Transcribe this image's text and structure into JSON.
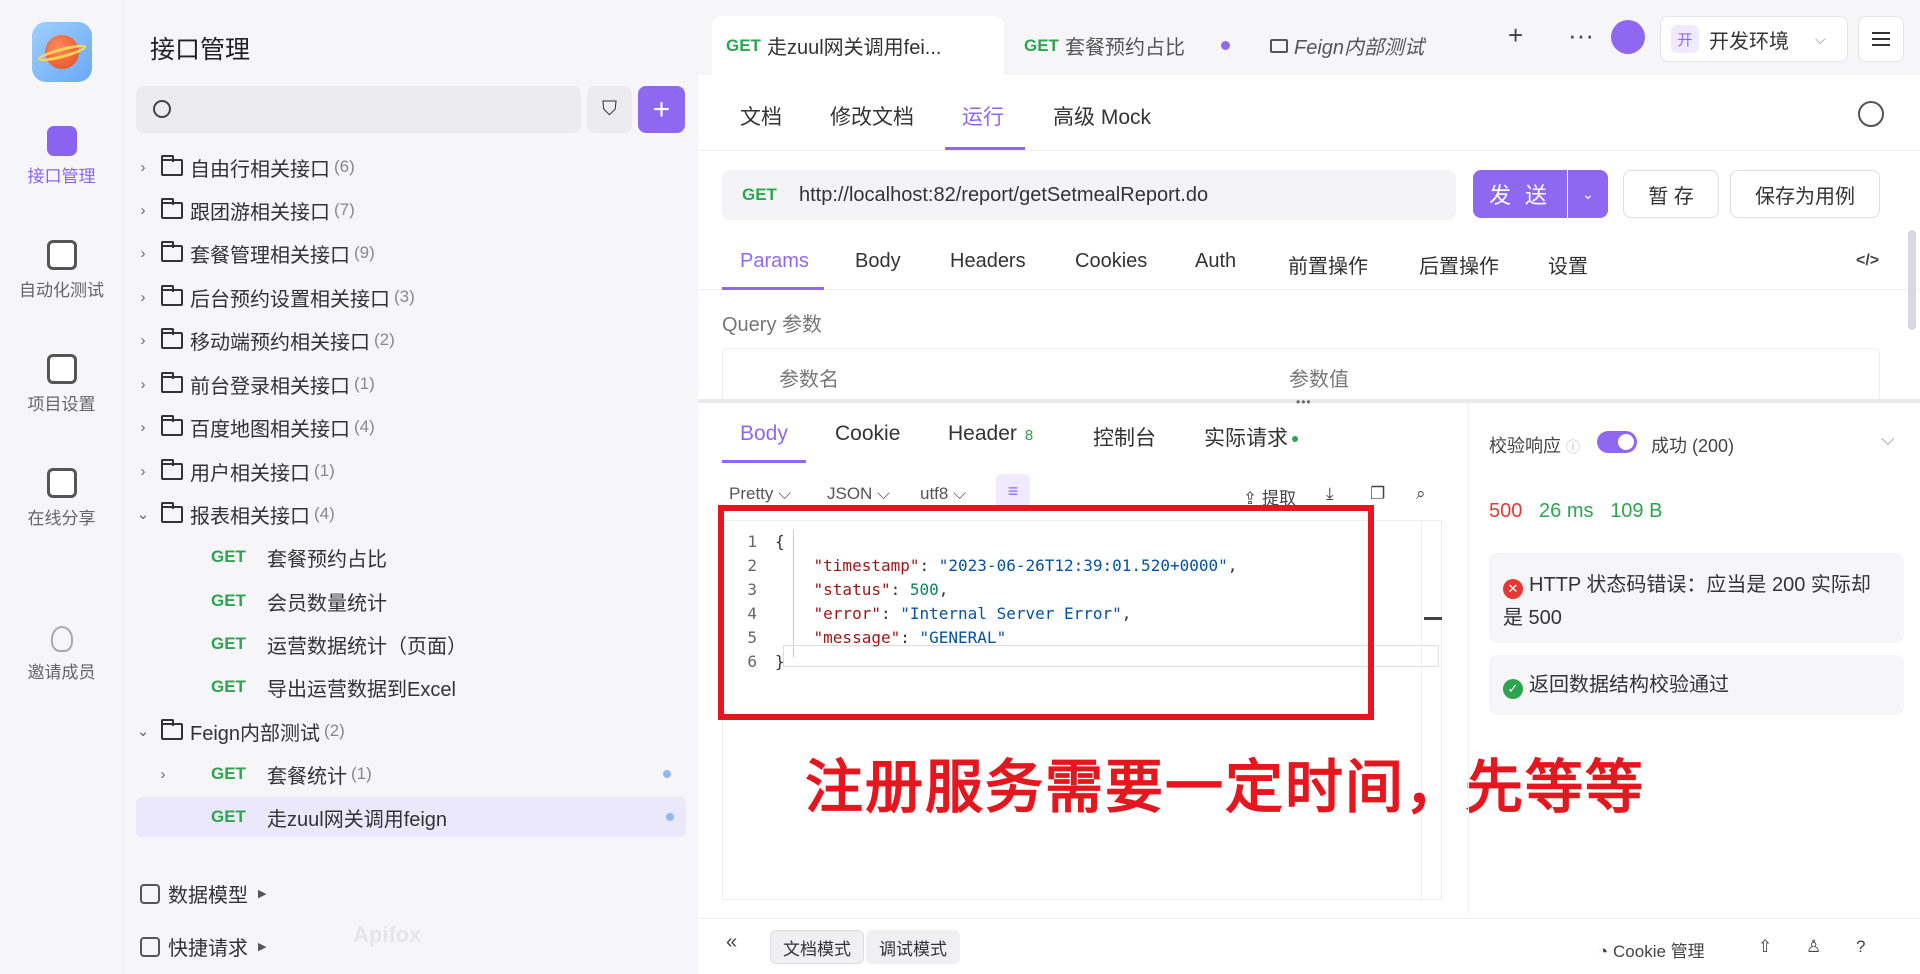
{
  "rail": {
    "items": [
      {
        "label": "接口管理",
        "icon": "api-management-icon"
      },
      {
        "label": "自动化测试",
        "icon": "automation-test-icon"
      },
      {
        "label": "项目设置",
        "icon": "project-settings-icon"
      },
      {
        "label": "在线分享",
        "icon": "online-share-icon"
      },
      {
        "label": "邀请成员",
        "icon": "invite-member-icon"
      }
    ]
  },
  "sidebar": {
    "title": "接口管理",
    "folders": [
      {
        "name": "自由行相关接口",
        "count": "(6)"
      },
      {
        "name": "跟团游相关接口",
        "count": "(7)"
      },
      {
        "name": "套餐管理相关接口",
        "count": "(9)"
      },
      {
        "name": "后台预约设置相关接口",
        "count": "(3)"
      },
      {
        "name": "移动端预约相关接口",
        "count": "(2)"
      },
      {
        "name": "前台登录相关接口",
        "count": "(1)"
      },
      {
        "name": "百度地图相关接口",
        "count": "(4)"
      },
      {
        "name": "用户相关接口",
        "count": "(1)"
      },
      {
        "name": "报表相关接口",
        "count": "(4)"
      }
    ],
    "report_items": [
      {
        "method": "GET",
        "name": "套餐预约占比"
      },
      {
        "method": "GET",
        "name": "会员数量统计"
      },
      {
        "method": "GET",
        "name": "运营数据统计（页面）"
      },
      {
        "method": "GET",
        "name": "导出运营数据到Excel"
      }
    ],
    "feign_folder": {
      "name": "Feign内部测试",
      "count": "(2)"
    },
    "feign_items": [
      {
        "method": "GET",
        "name": "套餐统计",
        "count": "(1)"
      },
      {
        "method": "GET",
        "name": "走zuul网关调用feign"
      }
    ],
    "bottom": [
      {
        "label": "数据模型"
      },
      {
        "label": "快捷请求"
      }
    ],
    "watermark": "Apifox"
  },
  "tabs": [
    {
      "method": "GET",
      "title": "走zuul网关调用fei..."
    },
    {
      "method": "GET",
      "title": "套餐预约占比"
    },
    {
      "method": "",
      "title": "Feign内部测试"
    }
  ],
  "env": {
    "badge": "开",
    "label": "开发环境"
  },
  "subtabs": [
    "文档",
    "修改文档",
    "运行",
    "高级 Mock"
  ],
  "request": {
    "method": "GET",
    "url": "http://localhost:82/report/getSetmealReport.do",
    "send_label": "发 送",
    "save_label": "暂 存",
    "save_case_label": "保存为用例"
  },
  "param_tabs": [
    "Params",
    "Body",
    "Headers",
    "Cookies",
    "Auth",
    "前置操作",
    "后置操作",
    "设置"
  ],
  "query": {
    "label": "Query 参数",
    "col_name": "参数名",
    "col_value": "参数值"
  },
  "response_tabs": {
    "body": "Body",
    "cookie": "Cookie",
    "header": "Header",
    "header_count": "8",
    "console": "控制台",
    "actual": "实际请求"
  },
  "format": {
    "pretty": "Pretty",
    "json": "JSON",
    "encoding": "utf8",
    "extract": "提取"
  },
  "response_body": {
    "ln": [
      "1",
      "2",
      "3",
      "4",
      "5",
      "6"
    ],
    "open": "{",
    "close": "}",
    "fields": [
      {
        "key": "\"timestamp\"",
        "value": "\"2023-06-26T12:39:01.520+0000\"",
        "sep": ",",
        "kind": "s"
      },
      {
        "key": "\"status\"",
        "value": "500",
        "sep": ",",
        "kind": "n"
      },
      {
        "key": "\"error\"",
        "value": "\"Internal Server Error\"",
        "sep": ",",
        "kind": "s"
      },
      {
        "key": "\"message\"",
        "value": "\"GENERAL\"",
        "sep": "",
        "kind": "s"
      }
    ]
  },
  "annotation": "注册服务需要一定时间，先等等",
  "validation": {
    "label": "校验响应",
    "result": "成功 (200)",
    "status_code": "500",
    "time": "26 ms",
    "size": "109 B",
    "error": "HTTP 状态码错误：应当是 200 实际却是 500",
    "ok": "返回数据结构校验通过"
  },
  "footer": {
    "doc_mode": "文档模式",
    "debug_mode": "调试模式",
    "cookie_mgmt": "Cookie 管理"
  },
  "colors": {
    "accent": "#8f68f2",
    "get": "#2da44e",
    "error": "#e53935",
    "annotation": "#e5161d"
  }
}
